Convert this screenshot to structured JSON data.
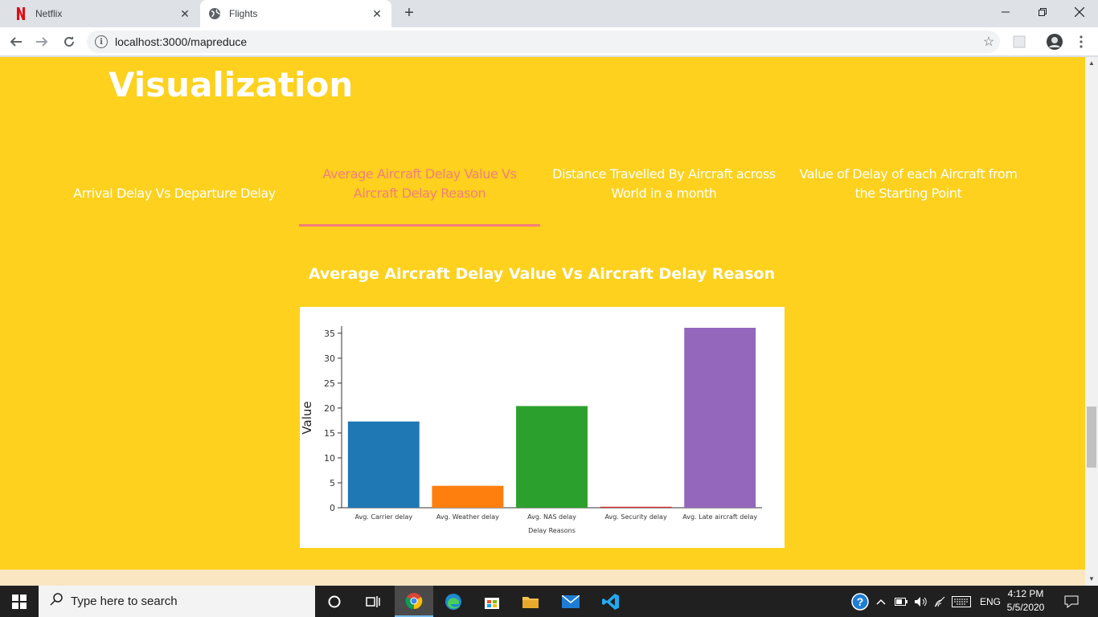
{
  "browser": {
    "tabs": [
      {
        "title": "Netflix",
        "icon": "netflix-icon",
        "active": false
      },
      {
        "title": "Flights",
        "icon": "globe-icon",
        "active": true
      }
    ],
    "url": "localhost:3000/mapreduce"
  },
  "page": {
    "title": "Visualization",
    "viz_tabs": [
      {
        "label": "Arrival Delay Vs Departure Delay",
        "active": false
      },
      {
        "label": "Average Aircraft Delay Value Vs Aircraft Delay Reason",
        "active": true
      },
      {
        "label": "Distance Travelled By Aircraft across World in a month",
        "active": false
      },
      {
        "label": "Value of Delay of each Aircraft from the Starting Point",
        "active": false
      }
    ],
    "chart_heading": "Average Aircraft Delay Value Vs Aircraft Delay Reason",
    "colors": {
      "background": "#fdd11e",
      "active_tab": "#f67d7d",
      "footer": "#fbe6c2"
    }
  },
  "chart_data": {
    "type": "bar",
    "categories": [
      "Avg. Carrier delay",
      "Avg. Weather delay",
      "Avg. NAS delay",
      "Avg. Security delay",
      "Avg. Late aircraft delay"
    ],
    "values": [
      17.3,
      4.4,
      20.4,
      0.15,
      36.1
    ],
    "colors": [
      "#1f77b4",
      "#ff7f0e",
      "#2ca02c",
      "#d62728",
      "#9467bd"
    ],
    "title": "",
    "xlabel": "Delay Reasons",
    "ylabel": "Value",
    "ylim": [
      0,
      36.1
    ],
    "yticks": [
      0,
      5,
      10,
      15,
      20,
      25,
      30,
      35
    ],
    "grid": false
  },
  "taskbar": {
    "search_placeholder": "Type here to search",
    "language": "ENG",
    "time": "4:12 PM",
    "date": "5/5/2020"
  }
}
